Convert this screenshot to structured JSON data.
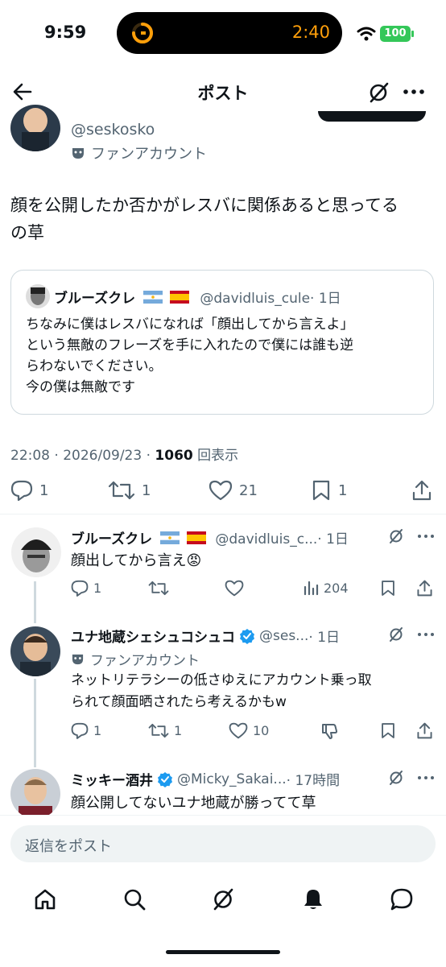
{
  "status_bar": {
    "time": "9:59",
    "timer": "2:40",
    "battery": "100"
  },
  "header": {
    "title": "ポスト"
  },
  "main_post": {
    "handle": "@seskosko",
    "fan_account_label": "ファンアカウント",
    "body_line1": "顔を公開したか否かがレスバに関係あると思ってる",
    "body_line2": "の草",
    "quote": {
      "name": "ブルーズクレ",
      "handle": "@davidluis_cule",
      "time": "· 1日",
      "lines": [
        "ちなみに僕はレスバになれば「顔出してから言えよ」",
        "という無敵のフレーズを手に入れたので僕には誰も逆",
        "らわないでください。",
        "今の僕は無敵です"
      ]
    },
    "timestamp": "22:08 · 2026/09/23 ·",
    "views_count": "1060",
    "views_label": "回表示",
    "actions": {
      "replies": "1",
      "reposts": "1",
      "likes": "21",
      "bookmarks": "1"
    }
  },
  "replies": [
    {
      "name": "ブルーズクレ",
      "handle": "@davidluis_c...",
      "time": "· 1日",
      "text": "顔出してから言え",
      "emoji": "😡",
      "replies": "1",
      "views": "204"
    },
    {
      "name": "ユナ地蔵シェシュコシュコ",
      "handle": "@ses...",
      "time": "· 1日",
      "fan_account_label": "ファンアカウント",
      "text_line1": "ネットリテラシーの低さゆえにアカウント乗っ取",
      "text_line2": "られて顔面晒されたら考えるかもw",
      "replies": "1",
      "reposts": "1",
      "likes": "10"
    },
    {
      "name": "ミッキー酒井",
      "handle": "@Micky_Sakai...",
      "time": "· 17時間",
      "text": "顔公開してないユナ地蔵が勝ってて草"
    }
  ],
  "reply_input": {
    "placeholder": "返信をポスト"
  },
  "colors": {
    "accent": "#1d9bf0",
    "muted": "#536471",
    "timer": "#ff9f0a",
    "battery": "#34c759"
  }
}
